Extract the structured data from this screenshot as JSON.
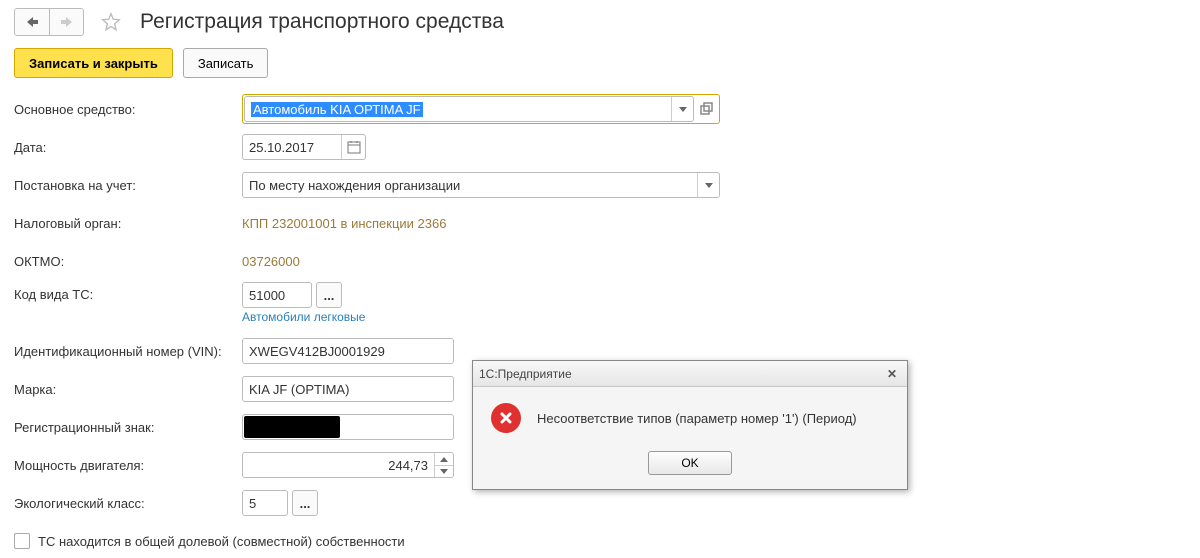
{
  "header": {
    "title": "Регистрация транспортного средства"
  },
  "toolbar": {
    "save_close": "Записать и закрыть",
    "save": "Записать"
  },
  "form": {
    "asset": {
      "label": "Основное средство:",
      "value": "Автомобиль KIA ОРТIMA JF"
    },
    "date": {
      "label": "Дата:",
      "value": "25.10.2017"
    },
    "registration": {
      "label": "Постановка на учет:",
      "value": "По месту нахождения организации"
    },
    "tax_authority": {
      "label": "Налоговый орган:",
      "value": "КПП 232001001 в инспекции 2366"
    },
    "oktmo": {
      "label": "ОКТМО:",
      "value": "03726000"
    },
    "ts_code": {
      "label": "Код вида ТС:",
      "value": "51000",
      "hint": "Автомобили легковые"
    },
    "vin": {
      "label": "Идентификационный номер (VIN):",
      "value": "XWEGV412BJ0001929"
    },
    "brand": {
      "label": "Марка:",
      "value": "KIA JF (OPTIMA)"
    },
    "reg_plate": {
      "label": "Регистрационный знак:"
    },
    "power": {
      "label": "Мощность двигателя:",
      "value": "244,73"
    },
    "eco_class": {
      "label": "Экологический класс:",
      "value": "5"
    },
    "shared": {
      "label": "ТС находится в общей долевой (совместной) собственности"
    }
  },
  "dialog": {
    "title": "1С:Предприятие",
    "message": "Несоответствие типов (параметр номер '1') (Период)",
    "ok": "OK"
  }
}
